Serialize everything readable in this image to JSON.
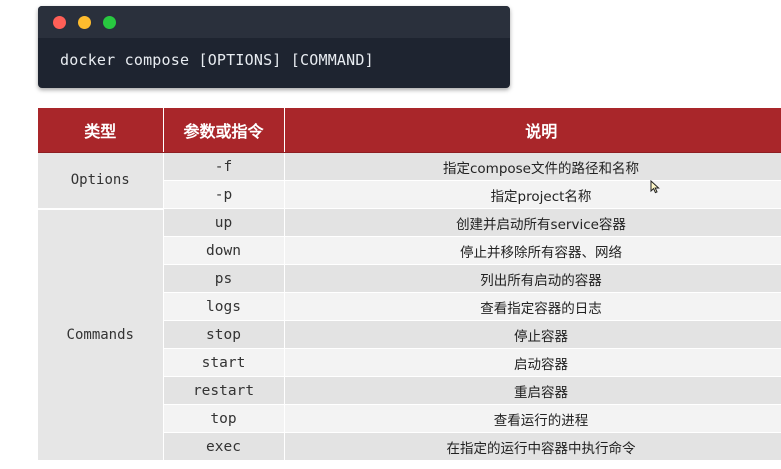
{
  "terminal": {
    "command": "docker compose [OPTIONS] [COMMAND]"
  },
  "table": {
    "headers": [
      "类型",
      "参数或指令",
      "说明"
    ],
    "groups": [
      {
        "type": "Options",
        "rows": [
          {
            "param": "-f",
            "desc": "指定compose文件的路径和名称"
          },
          {
            "param": "-p",
            "desc": "指定project名称"
          }
        ]
      },
      {
        "type": "Commands",
        "rows": [
          {
            "param": "up",
            "desc": "创建并启动所有service容器"
          },
          {
            "param": "down",
            "desc": "停止并移除所有容器、网络"
          },
          {
            "param": "ps",
            "desc": "列出所有启动的容器"
          },
          {
            "param": "logs",
            "desc": "查看指定容器的日志"
          },
          {
            "param": "stop",
            "desc": "停止容器"
          },
          {
            "param": "start",
            "desc": "启动容器"
          },
          {
            "param": "restart",
            "desc": "重启容器"
          },
          {
            "param": "top",
            "desc": "查看运行的进程"
          },
          {
            "param": "exec",
            "desc": "在指定的运行中容器中执行命令"
          }
        ]
      }
    ]
  },
  "colors": {
    "header_bg": "#a9262a",
    "terminal_bg": "#1e2430"
  }
}
